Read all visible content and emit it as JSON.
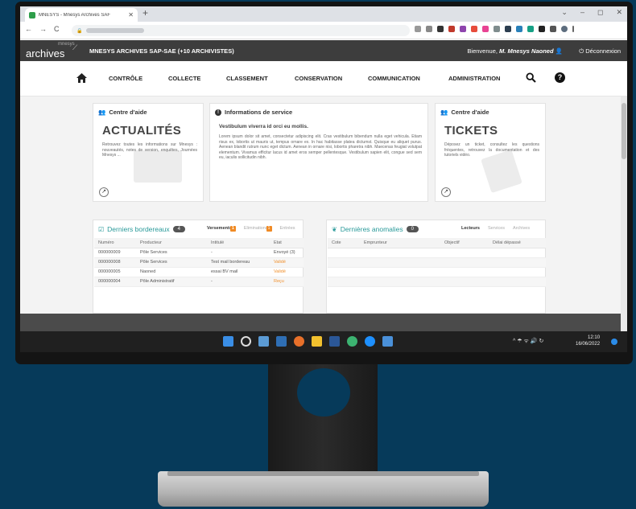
{
  "browser": {
    "tab_title": "MNESYS - Mnesys Archives SAF",
    "tab_close": "✕",
    "new_tab": "+",
    "window_controls": [
      "⌄",
      "–",
      "◻",
      "✕"
    ],
    "nav": [
      "←",
      "→",
      "C"
    ],
    "lock": "🔒"
  },
  "app": {
    "logo_small": "mnesys",
    "logo_main": "archives",
    "title": "MNESYS ARCHIVES SAP-SAE (+10 ARCHIVISTES)",
    "welcome_prefix": "Bienvenue,",
    "user": "M. Mnesys Naoned",
    "logout": "Déconnexion",
    "logout_icon": "⏻"
  },
  "menu": {
    "items": [
      "CONTRÔLE",
      "COLLECTE",
      "CLASSEMENT",
      "CONSERVATION",
      "COMMUNICATION",
      "ADMINISTRATION"
    ],
    "help_label": "?"
  },
  "cards": {
    "news": {
      "header": "Centre d'aide",
      "title": "ACTUALITÉS",
      "text": "Retrouvez toutes les informations sur Mnesys : nouveautés, notes de version, enquêtes, Journées Mnesys ..."
    },
    "info": {
      "header": "Informations de service",
      "subtitle": "Vestibulum viverra id orci eu mollis.",
      "text": "Lorem ipsum dolor sit amet, consectetur adipiscing elit. Cras vestibulum bibendum nulla eget vehicula. Etiam risus ex, lobortis ut mauris ut, tempus ornare ex. In hac habitasse platea dictumst. Quisque eu aliquet purus. Aenean blandit rutrum nunc eget dictum. Aenean in ornare nisi, lobortis pharetra nibh. Maecenas feugiat volutpat elementum. Vivamus efficitur lacus id amet eros semper pellentesque. Vestibulum sapien elit, congue sed sem eu, iaculis sollicitudin nibh."
    },
    "tickets": {
      "header": "Centre d'aide",
      "title": "TICKETS",
      "text": "Déposez un ticket, consultez les questions fréquentes, retrouvez la documentation et des tutoriels vidéo."
    }
  },
  "bordereaux": {
    "title": "Derniers bordereaux",
    "count": "4",
    "tabs": [
      {
        "label": "Versements",
        "badge": "1"
      },
      {
        "label": "Eliminations",
        "badge": "1"
      },
      {
        "label": "Entrées",
        "badge": ""
      }
    ],
    "columns": [
      "Numéro",
      "Producteur",
      "Intitulé",
      "Etat"
    ],
    "rows": [
      [
        "000000009",
        "Pôle Services",
        "-",
        "Envoyé (3)"
      ],
      [
        "000000008",
        "Pôle Services",
        "Test mail bordereau",
        "Validé"
      ],
      [
        "000000005",
        "Naoned",
        "essai BV mail",
        "Validé"
      ],
      [
        "000000004",
        "Pôle Administratif",
        "-",
        "Reçu"
      ]
    ]
  },
  "anomalies": {
    "title": "Dernières anomalies",
    "count": "0",
    "tabs": [
      "Lecteurs",
      "Services",
      "Archives"
    ],
    "columns": [
      "Cote",
      "Emprunteur",
      "Objectif",
      "Délai dépassé"
    ]
  },
  "taskbar": {
    "tray": "^ ☂ ᯤ 🔊 ↻",
    "time": "12:10",
    "date": "16/06/2022"
  },
  "colors": {
    "accent_teal": "#2a9a9a",
    "badge_orange": "#f08a24",
    "header_dark": "#3d3d3d",
    "background": "#063a5a"
  }
}
